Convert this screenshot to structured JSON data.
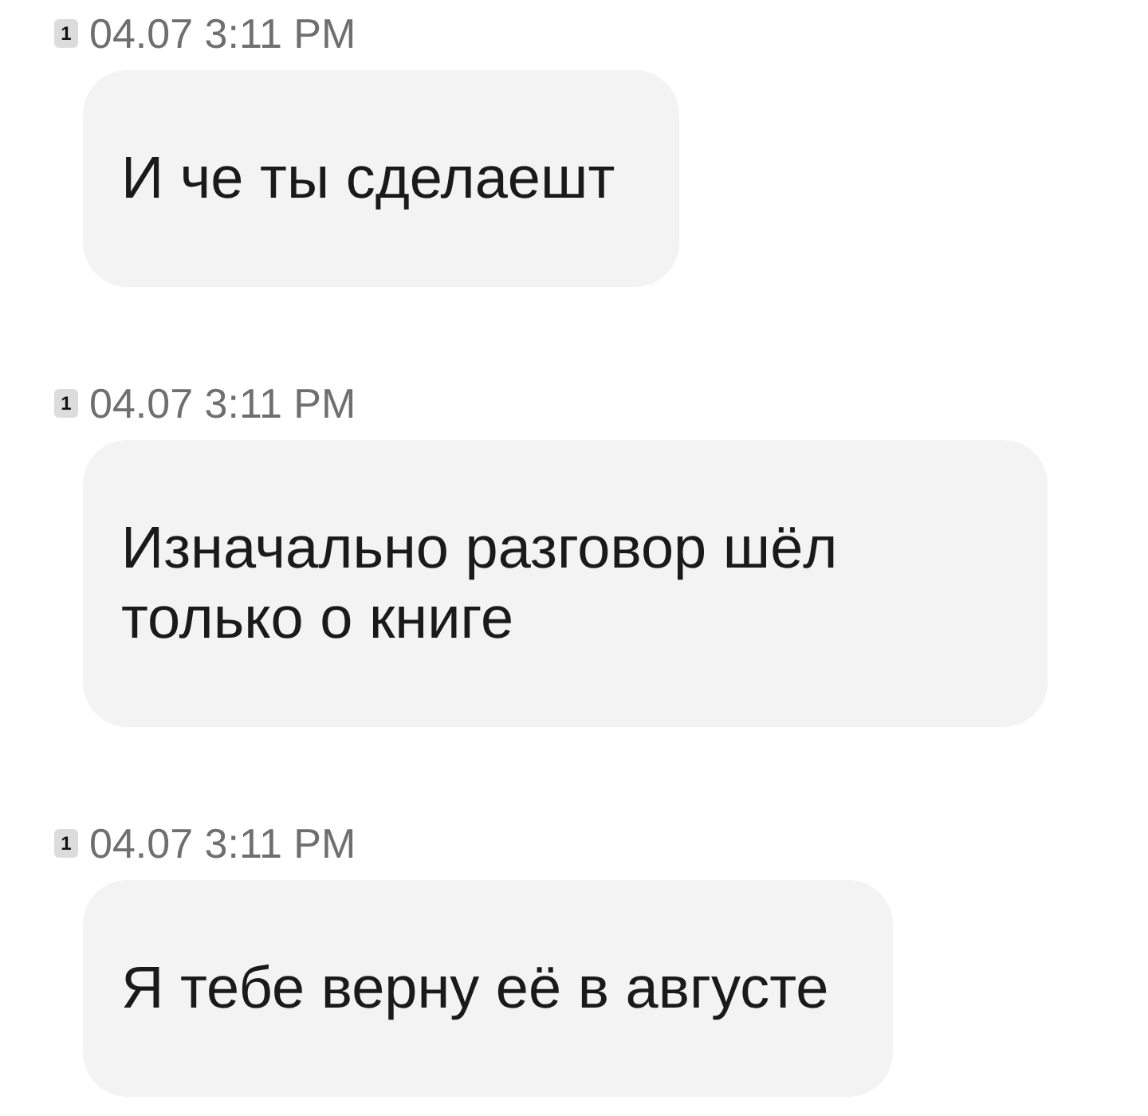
{
  "messages": [
    {
      "sim": "1",
      "time": "04.07 3:11 PM",
      "text": "И че ты сделаешт"
    },
    {
      "sim": "1",
      "time": "04.07 3:11 PM",
      "text": "Изначально разговор шёл только о книге"
    },
    {
      "sim": "1",
      "time": "04.07 3:11 PM",
      "text": "Я тебе верну её в августе"
    }
  ]
}
